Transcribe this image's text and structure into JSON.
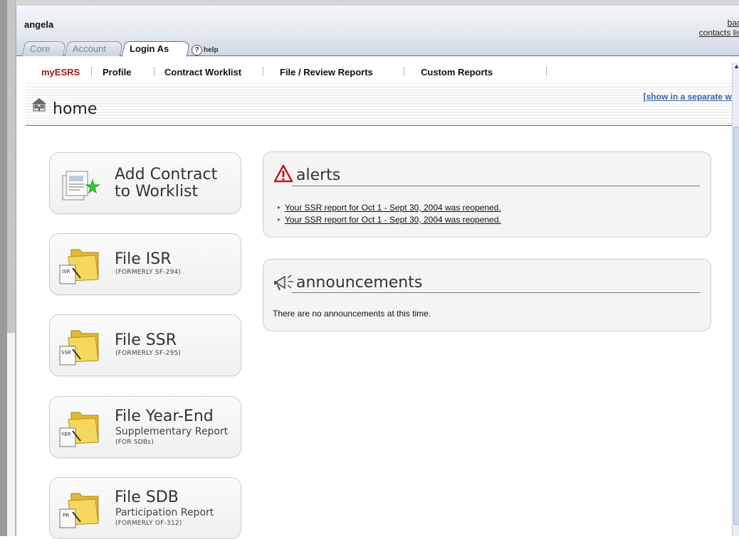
{
  "header": {
    "user": "angela",
    "links": [
      "bac",
      "contacts lis"
    ],
    "tabs": [
      "Core",
      "Account",
      "Login As"
    ],
    "help": "help"
  },
  "nav": {
    "items": [
      "myESRS",
      "Profile",
      "Contract Worklist",
      "File / Review Reports",
      "Custom Reports"
    ]
  },
  "page": {
    "title": "home",
    "separate_window": "[show in a separate windo"
  },
  "actions": [
    {
      "title_line1": "Add Contract",
      "title_line2": "to Worklist"
    },
    {
      "title": "File ISR",
      "note": "(FORMERLY SF-294)",
      "badge": "ISR"
    },
    {
      "title": "File SSR",
      "note": "(FORMERLY SF-295)",
      "badge": "SSR"
    },
    {
      "title": "File Year-End",
      "subtitle": "Supplementary Report",
      "note": "(FOR SDBs)",
      "badge": "YER"
    },
    {
      "title": "File SDB",
      "subtitle": "Participation Report",
      "note": "(FORMERLY OF-312)",
      "badge": "PR"
    }
  ],
  "alerts": {
    "title": "alerts",
    "items": [
      "Your SSR report for Oct 1 - Sept 30, 2004 was reopened.",
      "Your SSR report for Oct 1 - Sept 30, 2004 was reopened."
    ]
  },
  "announcements": {
    "title": "announcements",
    "empty_text": "There are no announcements at this time."
  },
  "colors": {
    "header_gradient_top": "#f4f6f9",
    "header_border": "#5b6f8d",
    "nav_current": "#a01818",
    "link_blue": "#3c64a8"
  }
}
